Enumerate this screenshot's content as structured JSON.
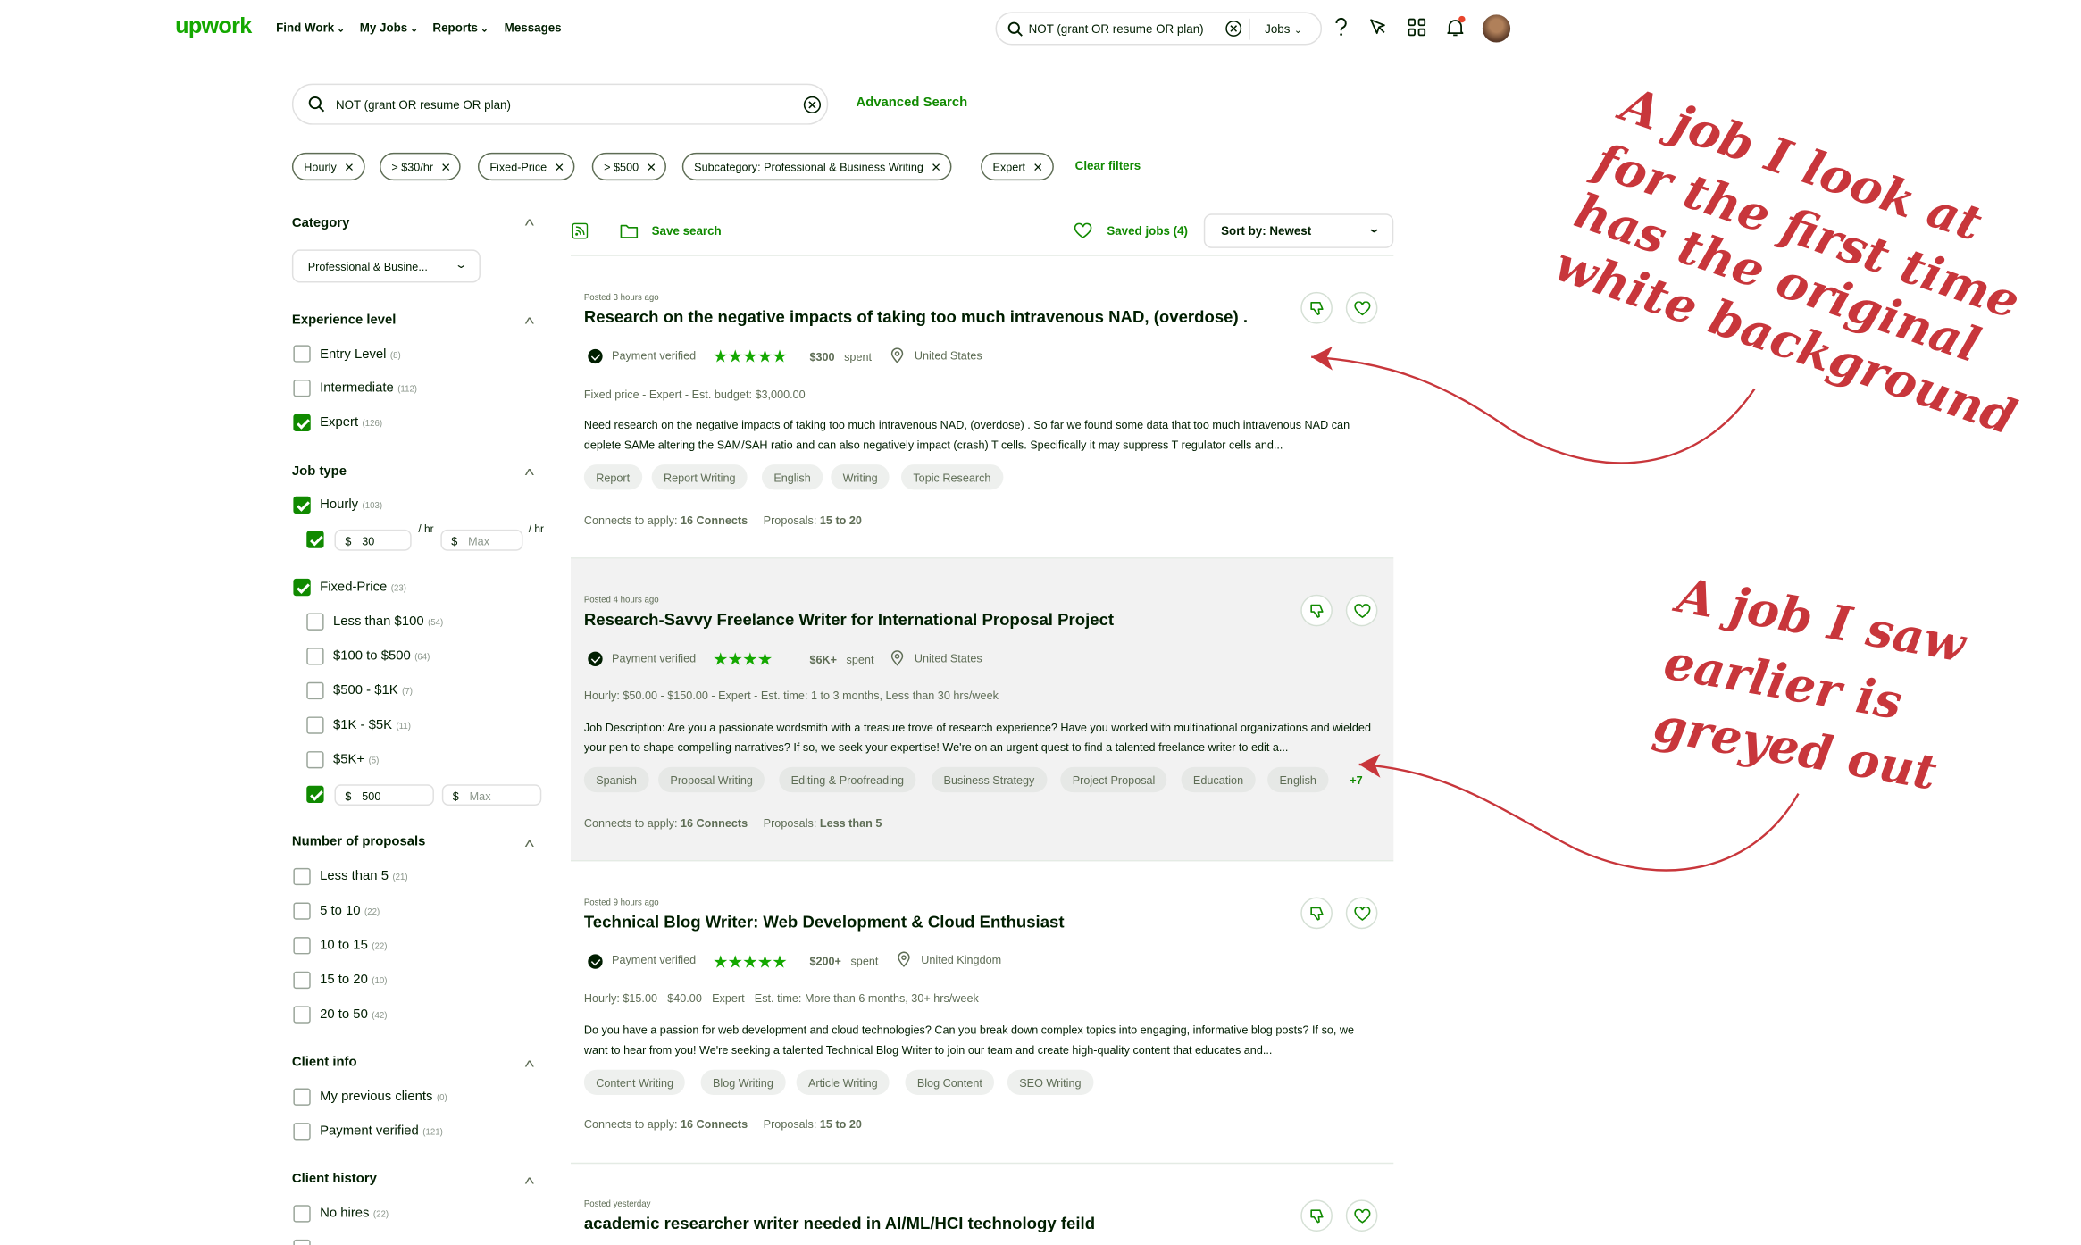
{
  "nav": {
    "logo": "upwork",
    "find_work": "Find Work",
    "my_jobs": "My Jobs",
    "reports": "Reports",
    "messages": "Messages",
    "search_query": "NOT (grant OR resume OR plan)",
    "search_scope": "Jobs"
  },
  "search": {
    "query": "NOT (grant OR resume OR plan)",
    "advanced_label": "Advanced Search"
  },
  "filter_chips": [
    "Hourly",
    "> $30/hr",
    "Fixed-Price",
    "> $500",
    "Subcategory: Professional & Business Writing",
    "Expert"
  ],
  "clear_filters": "Clear filters",
  "sidebar": {
    "category": {
      "title": "Category",
      "selected": "Professional & Busine..."
    },
    "experience": {
      "title": "Experience level",
      "options": [
        {
          "label": "Entry Level",
          "count": "(8)",
          "checked": false
        },
        {
          "label": "Intermediate",
          "count": "(112)",
          "checked": false
        },
        {
          "label": "Expert",
          "count": "(126)",
          "checked": true
        }
      ]
    },
    "job_type": {
      "title": "Job type",
      "hourly": {
        "label": "Hourly",
        "count": "(103)",
        "checked": true,
        "min": "30",
        "max_placeholder": "Max",
        "currency": "$",
        "unit": "/ hr"
      },
      "fixed": {
        "label": "Fixed-Price",
        "count": "(23)",
        "checked": true,
        "options": [
          {
            "label": "Less than $100",
            "count": "(54)"
          },
          {
            "label": "$100 to $500",
            "count": "(64)"
          },
          {
            "label": "$500 - $1K",
            "count": "(7)"
          },
          {
            "label": "$1K - $5K",
            "count": "(11)"
          },
          {
            "label": "$5K+",
            "count": "(5)"
          }
        ],
        "min": "500",
        "max_placeholder": "Max",
        "currency": "$"
      }
    },
    "proposals": {
      "title": "Number of proposals",
      "options": [
        {
          "label": "Less than 5",
          "count": "(21)"
        },
        {
          "label": "5 to 10",
          "count": "(22)"
        },
        {
          "label": "10 to 15",
          "count": "(22)"
        },
        {
          "label": "15 to 20",
          "count": "(10)"
        },
        {
          "label": "20 to 50",
          "count": "(42)"
        }
      ]
    },
    "client_info": {
      "title": "Client info",
      "options": [
        {
          "label": "My previous clients",
          "count": "(0)"
        },
        {
          "label": "Payment verified",
          "count": "(121)"
        }
      ]
    },
    "client_history": {
      "title": "Client history",
      "options": [
        {
          "label": "No hires",
          "count": "(22)"
        }
      ]
    }
  },
  "toolbar": {
    "save_search": "Save search",
    "saved_jobs": "Saved jobs (4)",
    "sort": "Sort by: Newest"
  },
  "jobs": [
    {
      "posted": "Posted 3 hours ago",
      "title": "Research on the negative impacts of taking too much intravenous NAD, (overdose) .",
      "payment": "Payment verified",
      "stars": "★★★★★",
      "spent_amount": "$300",
      "spent_label": "spent",
      "location": "United States",
      "meta": "Fixed price - Expert - Est. budget: $3,000.00",
      "description": "Need research on the negative impacts of taking too much intravenous NAD, (overdose) . So far we found some data that too much intravenous NAD can deplete SAMe altering the SAM/SAH ratio and can also negatively impact (crash) T cells. Specifically it may suppress T regulator cells and...",
      "tags": [
        "Report",
        "Report Writing",
        "English",
        "Writing",
        "Topic Research"
      ],
      "connects_label": "Connects to apply:",
      "connects": "16 Connects",
      "proposals_label": "Proposals:",
      "proposals": "15 to 20",
      "seen": false
    },
    {
      "posted": "Posted 4 hours ago",
      "title": "Research-Savvy Freelance Writer for International Proposal Project",
      "payment": "Payment verified",
      "stars": "★★★★",
      "spent_amount": "$6K+",
      "spent_label": "spent",
      "location": "United States",
      "meta": "Hourly: $50.00 - $150.00 - Expert - Est. time: 1 to 3 months, Less than 30 hrs/week",
      "description": "Job Description: Are you a passionate wordsmith with a treasure trove of research experience? Have you worked with multinational organizations and wielded your pen to shape compelling narratives? If so, we seek your expertise! We're on an urgent quest to find a talented freelance writer to edit a...",
      "tags": [
        "Spanish",
        "Proposal Writing",
        "Editing & Proofreading",
        "Business Strategy",
        "Project Proposal",
        "Education",
        "English"
      ],
      "more": "+7",
      "connects_label": "Connects to apply:",
      "connects": "16 Connects",
      "proposals_label": "Proposals:",
      "proposals": "Less than 5",
      "seen": true
    },
    {
      "posted": "Posted 9 hours ago",
      "title": "Technical Blog Writer: Web Development & Cloud Enthusiast",
      "payment": "Payment verified",
      "stars": "★★★★★",
      "spent_amount": "$200+",
      "spent_label": "spent",
      "location": "United Kingdom",
      "meta": "Hourly: $15.00 - $40.00 - Expert - Est. time: More than 6 months, 30+ hrs/week",
      "description": "Do you have a passion for web development and cloud technologies? Can you break down complex topics into engaging, informative blog posts? If so, we want to hear from you! We're seeking a talented Technical Blog Writer to join our team and create high-quality content that educates and...",
      "tags": [
        "Content Writing",
        "Blog Writing",
        "Article Writing",
        "Blog Content",
        "SEO Writing"
      ],
      "connects_label": "Connects to apply:",
      "connects": "16 Connects",
      "proposals_label": "Proposals:",
      "proposals": "15 to 20",
      "seen": false
    },
    {
      "posted": "Posted yesterday",
      "title": "academic researcher writer needed in AI/ML/HCI technology feild"
    }
  ],
  "annotations": {
    "first": [
      "A job I look at",
      "for the first time",
      "has the original",
      "white background"
    ],
    "second": [
      "A job I saw",
      "earlier is",
      "greyed out"
    ]
  },
  "colors": {
    "brand": "#14a800",
    "link": "#108a00",
    "annotation": "#c8363b",
    "seen_bg": "#f2f2f2"
  }
}
